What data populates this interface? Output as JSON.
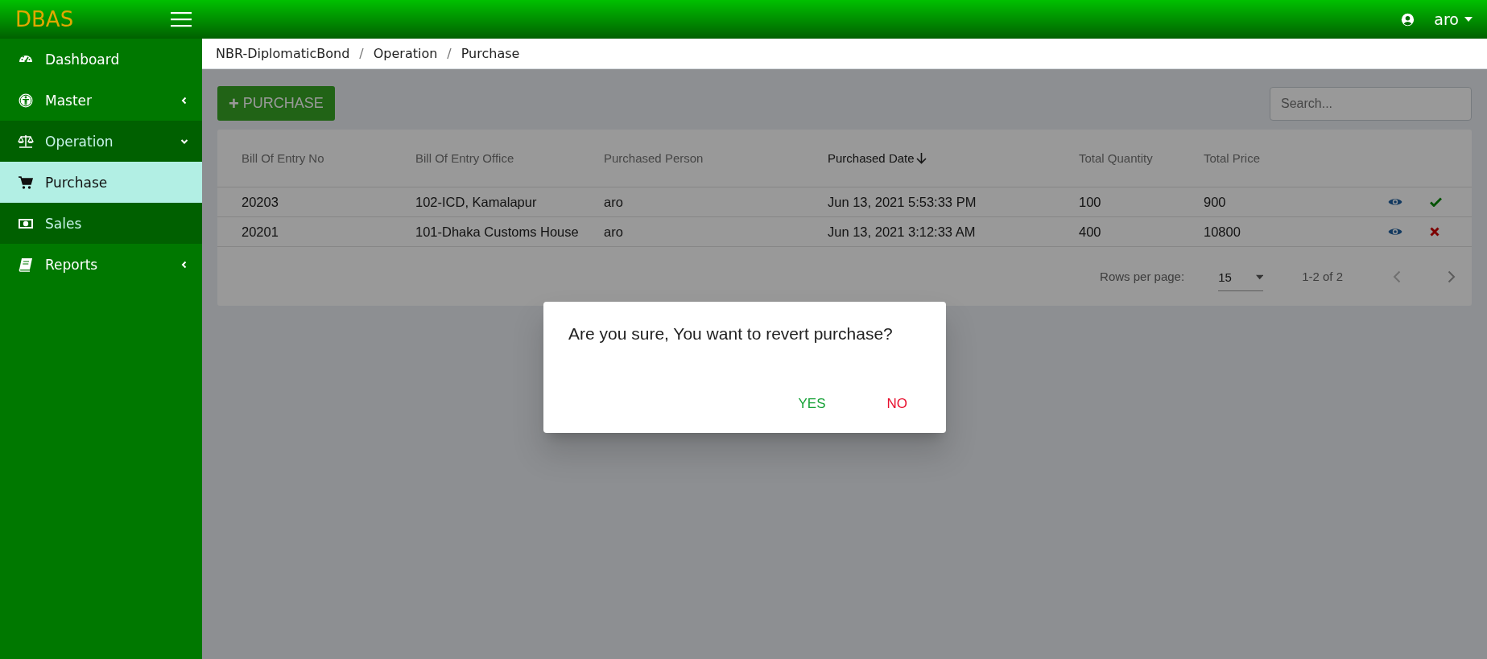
{
  "brand": "DBAS",
  "user": {
    "name": "aro"
  },
  "sidebar": {
    "items": [
      {
        "label": "Dashboard",
        "selected": false
      },
      {
        "label": "Master",
        "selected": false,
        "expanded": false
      },
      {
        "label": "Operation",
        "selected": false,
        "expanded": true,
        "children": [
          {
            "label": "Purchase",
            "selected": true
          },
          {
            "label": "Sales",
            "selected": false
          }
        ]
      },
      {
        "label": "Reports",
        "selected": false,
        "expanded": false
      }
    ]
  },
  "breadcrumb": [
    {
      "label": "NBR-DiplomaticBond"
    },
    {
      "separator": "/",
      "label": "Operation"
    },
    {
      "separator": "/",
      "label": "Purchase"
    }
  ],
  "add_button": {
    "icon": "+",
    "label": "PURCHASE"
  },
  "search": {
    "placeholder": "Search..."
  },
  "table": {
    "columns": [
      {
        "label": "Bill Of Entry No",
        "sorted": false
      },
      {
        "label": "Bill Of Entry Office",
        "sorted": false
      },
      {
        "label": "Purchased Person",
        "sorted": false
      },
      {
        "label": "Purchased Date",
        "sorted": true
      },
      {
        "label": "Total Quantity",
        "sorted": false
      },
      {
        "label": "Total Price",
        "sorted": false
      }
    ],
    "rows": [
      {
        "cells": [
          "20203",
          "102-ICD, Kamalapur",
          "aro",
          "Jun 13, 2021 5:53:33 PM",
          "100",
          "900"
        ],
        "kind": "approved"
      },
      {
        "cells": [
          "20201",
          "101-Dhaka Customs House",
          "aro",
          "Jun 13, 2021 3:12:33 AM",
          "400",
          "10800"
        ],
        "kind": "rejected"
      }
    ]
  },
  "pagination": {
    "rows_per_page_label": "Rows per page:",
    "rows_per_page": "15",
    "range": "1-2 of 2"
  },
  "dialog": {
    "message": "Are you sure, You want to revert purchase?",
    "buttons": [
      {
        "label": "YES",
        "kind": "confirm"
      },
      {
        "label": "NO",
        "kind": "cancel"
      }
    ]
  }
}
